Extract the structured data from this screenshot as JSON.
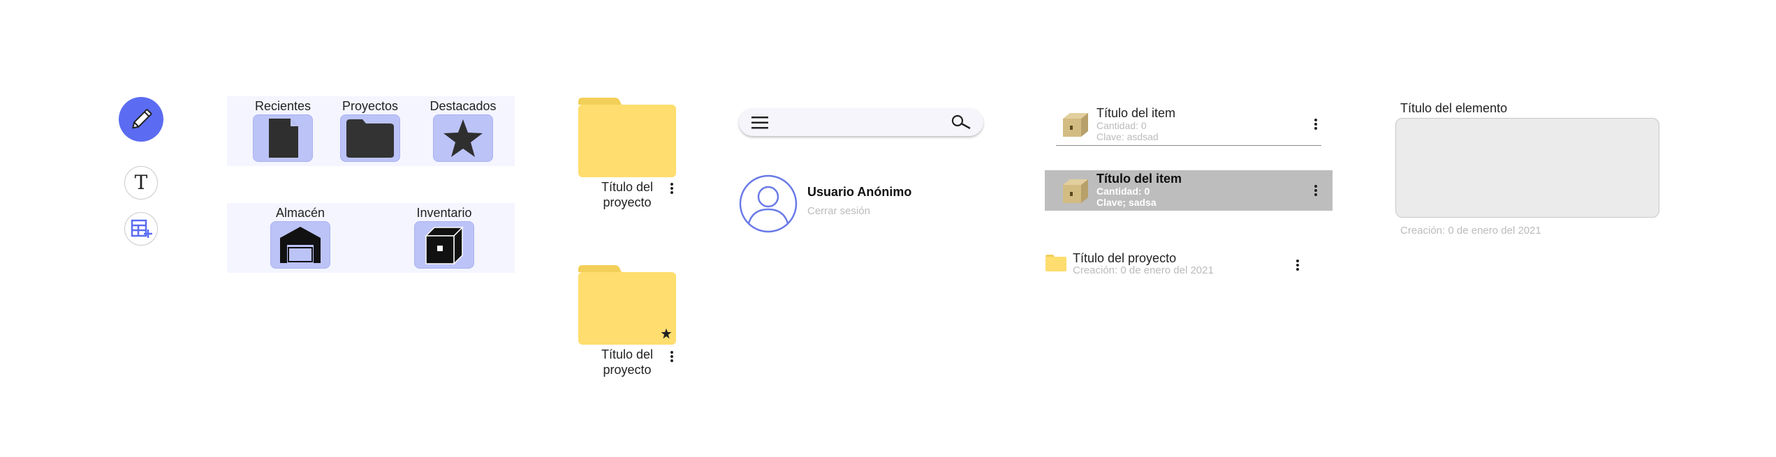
{
  "categories_top": [
    {
      "label": "Recientes",
      "icon": "document-icon"
    },
    {
      "label": "Proyectos",
      "icon": "folder-icon"
    },
    {
      "label": "Destacados",
      "icon": "star-icon"
    }
  ],
  "categories_bottom": [
    {
      "label": "Almacén",
      "icon": "warehouse-icon"
    },
    {
      "label": "Inventario",
      "icon": "box-icon"
    }
  ],
  "folders": [
    {
      "title_line1": "Título del",
      "title_line2": "proyecto",
      "starred": false
    },
    {
      "title_line1": "Título del",
      "title_line2": "proyecto",
      "starred": true
    }
  ],
  "user": {
    "name": "Usuario Anónimo",
    "logout": "Cerrar sesión"
  },
  "items": [
    {
      "title": "Título del item",
      "quantity": "Cantidad: 0",
      "key": "Clave: asdsad",
      "selected": false
    },
    {
      "title": "Título del item",
      "quantity": "Cantidad: 0",
      "key": "Clave; sadsa",
      "selected": true
    }
  ],
  "project_row": {
    "title": "Título del proyecto",
    "created": "Creación: 0 de enero del 2021"
  },
  "element_card": {
    "label": "Título del elemento",
    "created": "Creación: 0 de enero del 2021"
  },
  "colors": {
    "accent": "#5b6cf2",
    "tile": "#bcc3f7",
    "panel": "#f4f5ff",
    "folder": "#ffdd6e",
    "selected_row": "#bdbdbd"
  }
}
